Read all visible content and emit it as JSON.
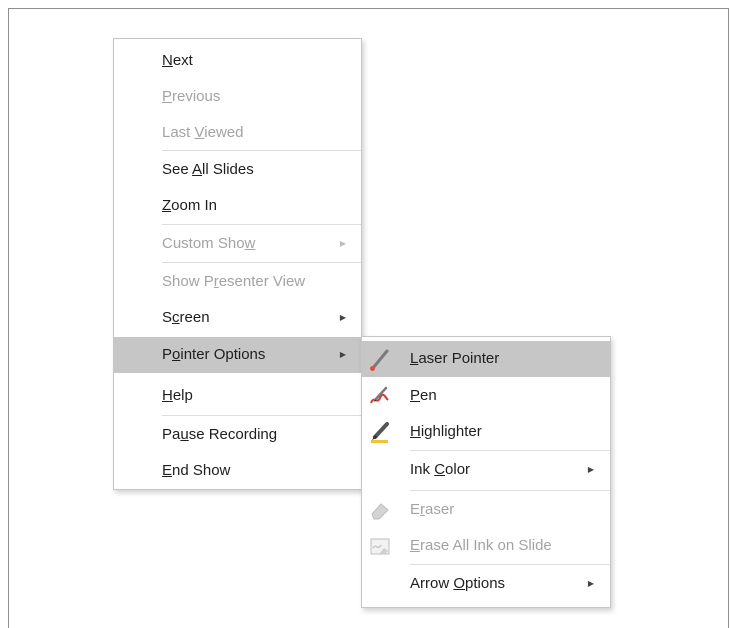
{
  "context_menu": {
    "items": [
      {
        "label": "Next",
        "mn": 0,
        "disabled": false
      },
      {
        "label": "Previous",
        "mn": 0,
        "disabled": true
      },
      {
        "label": "Last Viewed",
        "mn": 5,
        "disabled": true
      },
      {
        "label": "See All Slides",
        "mn": 4,
        "disabled": false
      },
      {
        "label": "Zoom In",
        "mn": 0,
        "disabled": false
      },
      {
        "label": "Custom Show",
        "mn": 10,
        "disabled": true,
        "submenu": true
      },
      {
        "label": "Show Presenter View",
        "mn": 6,
        "disabled": true
      },
      {
        "label": "Screen",
        "mn": 1,
        "disabled": false,
        "submenu": true
      },
      {
        "label": "Pointer Options",
        "mn": 1,
        "disabled": false,
        "submenu": true,
        "highlighted": true
      },
      {
        "label": "Help",
        "mn": 0,
        "disabled": false
      },
      {
        "label": "Pause Recording",
        "mn": 2,
        "disabled": false
      },
      {
        "label": "End Show",
        "mn": 0,
        "disabled": false
      }
    ]
  },
  "pointer_submenu": {
    "items": [
      {
        "label": "Laser Pointer",
        "mn": 0,
        "disabled": false,
        "icon": "laser-pointer-icon",
        "highlighted": true
      },
      {
        "label": "Pen",
        "mn": 0,
        "disabled": false,
        "icon": "pen-icon"
      },
      {
        "label": "Highlighter",
        "mn": 0,
        "disabled": false,
        "icon": "highlighter-icon"
      },
      {
        "label": "Ink Color",
        "mn": 4,
        "disabled": false,
        "submenu": true
      },
      {
        "label": "Eraser",
        "mn": 1,
        "disabled": true,
        "icon": "eraser-icon"
      },
      {
        "label": "Erase All Ink on Slide",
        "mn": 0,
        "disabled": true,
        "icon": "erase-all-ink-icon"
      },
      {
        "label": "Arrow Options",
        "mn": 6,
        "disabled": false,
        "submenu": true
      }
    ]
  },
  "colors": {
    "highlight": "#c6c6c6",
    "disabled_text": "#a3a3a3",
    "pen_red": "#d9362b",
    "highlighter_yellow": "#f2c230",
    "laser_red": "#e04a3a"
  }
}
